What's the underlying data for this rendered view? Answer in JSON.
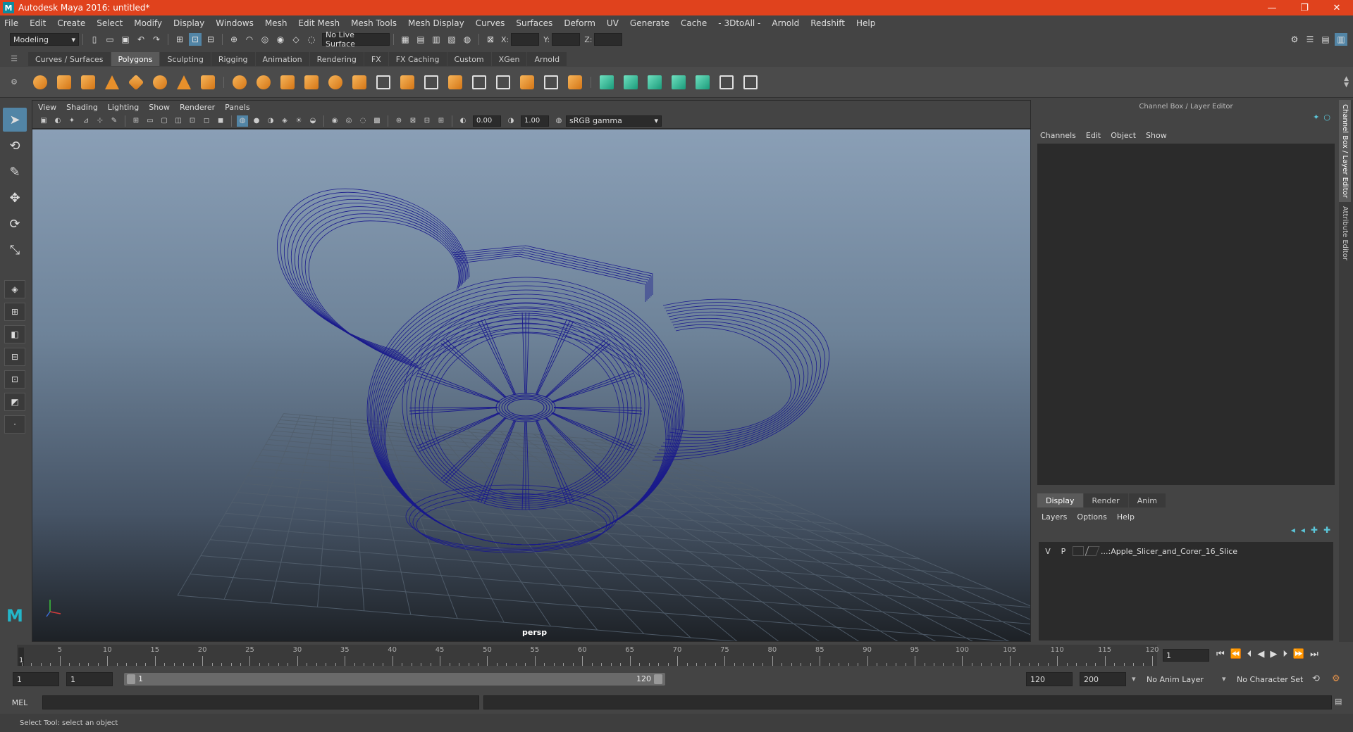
{
  "window": {
    "title": "Autodesk Maya 2016: untitled*",
    "minimize": "—",
    "restore": "❐",
    "close": "✕"
  },
  "menubar": [
    "File",
    "Edit",
    "Create",
    "Select",
    "Modify",
    "Display",
    "Windows",
    "Mesh",
    "Edit Mesh",
    "Mesh Tools",
    "Mesh Display",
    "Curves",
    "Surfaces",
    "Deform",
    "UV",
    "Generate",
    "Cache",
    "- 3DtoAll -",
    "Arnold",
    "Redshift",
    "Help"
  ],
  "statusline": {
    "mode": "Modeling",
    "live_surface": "No Live Surface",
    "x_label": "X:",
    "y_label": "Y:",
    "z_label": "Z:"
  },
  "shelf_tabs": [
    "Curves / Surfaces",
    "Polygons",
    "Sculpting",
    "Rigging",
    "Animation",
    "Rendering",
    "FX",
    "FX Caching",
    "Custom",
    "XGen",
    "Arnold"
  ],
  "shelf_active": "Polygons",
  "viewport": {
    "menu": [
      "View",
      "Shading",
      "Lighting",
      "Show",
      "Renderer",
      "Panels"
    ],
    "exposure": "0.00",
    "gamma": "1.00",
    "color_space": "sRGB gamma",
    "camera_label": "persp"
  },
  "channel_box": {
    "title": "Channel Box / Layer Editor",
    "menu": [
      "Channels",
      "Edit",
      "Object",
      "Show"
    ],
    "layer_tabs": [
      "Display",
      "Render",
      "Anim"
    ],
    "layer_menu": [
      "Layers",
      "Options",
      "Help"
    ],
    "layer": {
      "visible": "V",
      "playback": "P",
      "name": "...:Apple_Slicer_and_Corer_16_Slice"
    }
  },
  "side_tabs": [
    "Channel Box / Layer Editor",
    "Attribute Editor"
  ],
  "time_slider": {
    "labels": [
      "5",
      "10",
      "15",
      "20",
      "25",
      "30",
      "35",
      "40",
      "45",
      "50",
      "55",
      "60",
      "65",
      "70",
      "75",
      "80",
      "85",
      "90",
      "95",
      "100",
      "105",
      "110",
      "115",
      "120"
    ],
    "start_label": "1",
    "current_frame": "1"
  },
  "range_slider": {
    "start": "1",
    "playback_start": "1",
    "range_start": "1",
    "range_end": "120",
    "playback_end": "120",
    "end": "200",
    "anim_layer": "No Anim Layer",
    "character_set": "No Character Set"
  },
  "command_line": {
    "label": "MEL"
  },
  "help_line": "Select Tool: select an object",
  "colors": {
    "titlebar": "#e0421d",
    "accent": "#5285a6",
    "wireframe": "#1a1a8c"
  }
}
